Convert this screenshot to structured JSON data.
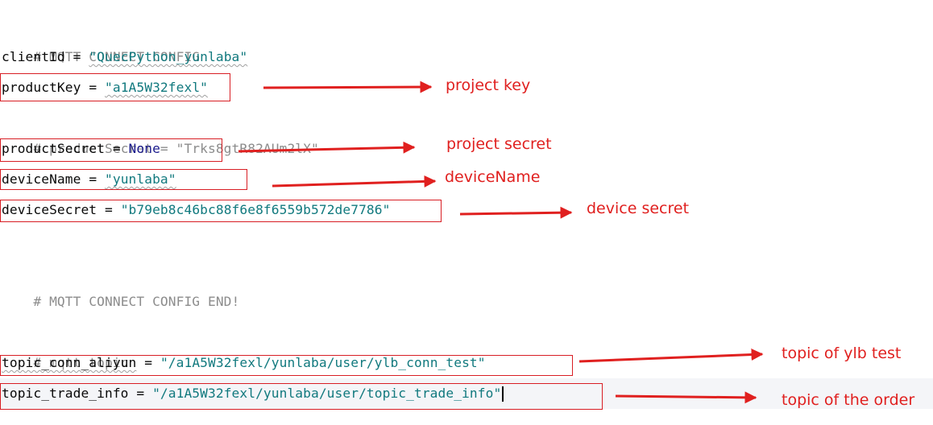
{
  "colors": {
    "annotation": "#e0201f",
    "box": "#d81e24",
    "comment": "#8c8c8c",
    "string": "#11797e",
    "keyword": "#1a1a8c"
  },
  "code": {
    "comment_config": "# MQTT CONNECT CONFIG",
    "client_id_name": "clientId",
    "client_id_value": "\"QuecPython_yunlaba\"",
    "product_key_name": "productKey",
    "product_key_value": "\"a1A5W32fexl\"",
    "product_secret_comment": "# productSecret = \"Trks8gtR82AUm2lX\"",
    "product_secret_name": "productSecret",
    "product_secret_value": "None",
    "device_name_name": "deviceName",
    "device_name_value": "\"yunlaba\"",
    "device_secret_name": "deviceSecret",
    "device_secret_value": "\"b79eb8c46bc88f6e8f6559b572de7786\"",
    "comment_config_end": "# MQTT CONNECT CONFIG END!",
    "comment_topic": "# mqtt topic",
    "topic_conn_name": "topic_conn_aliyun",
    "topic_conn_value": "\"/a1A5W32fexl/yunlaba/user/ylb_conn_test\"",
    "topic_trade_name": "topic_trade_info",
    "topic_trade_value": "\"/a1A5W32fexl/yunlaba/user/topic_trade_info\"",
    "assign": " = "
  },
  "annotations": {
    "project_key": "project key",
    "project_secret": "project secret",
    "device_name": "deviceName",
    "device_secret": "device secret",
    "topic_ylb_test": "topic of ylb test",
    "topic_order": "topic of the order"
  }
}
